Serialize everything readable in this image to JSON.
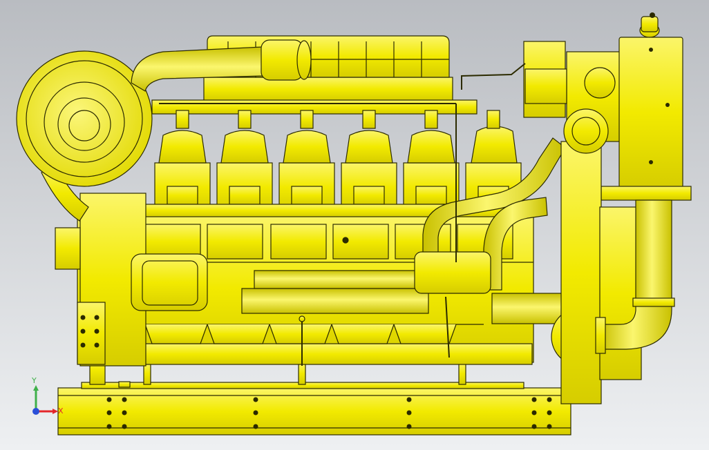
{
  "viewport": {
    "background_top": "#b9bcc1",
    "background_bottom": "#eef0f2"
  },
  "model": {
    "body_color": "#f2ea00",
    "shade_color": "#c9c100",
    "edge_color": "#2b2a00",
    "cylinder_count": 6
  },
  "triad": {
    "x_label": "X",
    "y_label": "Y",
    "x_color": "#e3262b",
    "y_color": "#3fb04a",
    "z_color": "#2a4fd8"
  }
}
